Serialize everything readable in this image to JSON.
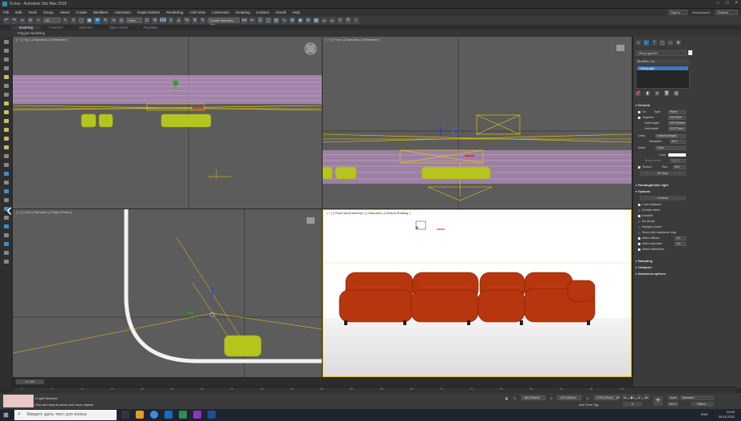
{
  "window": {
    "title": "9.max - Autodesk 3ds Max 2018",
    "workspaces_label": "Workspaces:",
    "workspaces_value": "Default",
    "signin_value": "Sign In"
  },
  "menu": [
    "File",
    "Edit",
    "Tools",
    "Group",
    "Views",
    "Create",
    "Modifiers",
    "Animation",
    "Graph Editors",
    "Rendering",
    "Civil View",
    "Customize",
    "Scripting",
    "Content",
    "Arnold",
    "Help"
  ],
  "toolbar": {
    "selection_filter": "All",
    "ref_coord": "View",
    "named_selection": "Create Selection Set"
  },
  "ribbon": {
    "tabs": [
      "Modeling",
      "Freeform",
      "Selection",
      "Object Paint",
      "Populate"
    ],
    "active_tab": "Modeling",
    "sub_label": "Polygon Modeling"
  },
  "viewports": {
    "top": "[ + ] [ Top ] [ Standard ] [ Wireframe ]",
    "front": "[ + ] [ Front ] [ Standard ] [ Wireframe ]",
    "left": "[ + ] [ Left ] [ Standard ] [ Edged Faces ]",
    "perspective": "[ + ] [ PhysCam(Camera)1 ] [ Standard ] [ Default Shading ]"
  },
  "command_panel": {
    "object_name": "VRayLight001",
    "modifier_list": "Modifier List",
    "stack_item": "VRayLight",
    "general": {
      "header": "General",
      "on_label": "On",
      "type_label": "Type",
      "type_value": "Plane",
      "targeted_label": "Targeted",
      "targeted_value": "200,0mm",
      "half_length_label": "Half-length:",
      "half_length_value": "576,253mm",
      "half_width_label": "Half-width:",
      "half_width_value": "93,573mm",
      "units_label": "Units",
      "units_value": "Default (image)",
      "multiplier_label": "Multiplier:",
      "multiplier_value": "30,0",
      "mode_label": "Mode",
      "mode_value": "Color",
      "color_label": "Color",
      "temperature_label": "Temperature:",
      "temperature_value": "6500,0",
      "texture_label": "Texture",
      "res_label": "Res.",
      "res_value": "512",
      "no_map": "No Map"
    },
    "rect_header": "Rectangle/disc light",
    "options": {
      "header": "Options",
      "exclude": "Exclude",
      "items": [
        "Cast shadows",
        "Double-sided",
        "Invisible",
        "No decay",
        "Skylight portal",
        "Store with irradiance map",
        "Affect diffuse",
        "Affect specular",
        "Affect reflections"
      ],
      "simple_label": "Simple",
      "affect_diffuse_value": "1,0",
      "affect_specular_value": "1,0"
    },
    "sampling_header": "Sampling",
    "viewport_header": "Viewport",
    "advanced_header": "Advanced options"
  },
  "timeline": {
    "slider": "0 / 100",
    "ticks": [
      "0",
      "5",
      "10",
      "15",
      "20",
      "25",
      "30",
      "35",
      "40",
      "45",
      "50",
      "55",
      "60",
      "65",
      "70",
      "75",
      "80",
      "85",
      "90",
      "95",
      "100"
    ]
  },
  "status": {
    "selection": "1 Light Selected",
    "prompt": "Click and drag to select and move objects",
    "x_label": "X:",
    "x_value": "-860,284mm",
    "y_label": "Y:",
    "y_value": "-875,466mm",
    "z_label": "Z:",
    "z_value": "1209,315mm",
    "grid": "Grid = 100,0mm",
    "add_time_tag": "Add Time Tag",
    "auto": "Auto",
    "selected": "Selected",
    "set_k": "Set K.",
    "filters": "Filters...",
    "frame": "0"
  },
  "taskbar": {
    "search_placeholder": "Введите здесь текст для поиска",
    "time": "23:40",
    "date": "08.10.2020",
    "lang": "ENG"
  },
  "colors": {
    "viewport_bg": "#5c5c5c",
    "selected_light": "#f5d000",
    "sofa_green": "#b6c51e",
    "sofa_red": "#c03a10",
    "accent_blue": "#2d6b9a"
  }
}
